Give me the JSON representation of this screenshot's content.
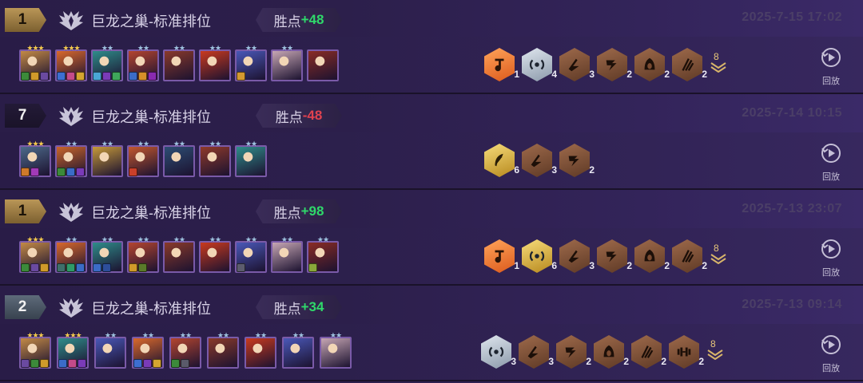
{
  "matches": [
    {
      "rank": "1",
      "rank_style": "gold",
      "mode": "巨龙之巢-标准排位",
      "points_label": "胜点",
      "points_value": "+48",
      "points_dir": "up",
      "date": "2025-7-15 17:02",
      "champions": [
        {
          "stars": "★★★",
          "star_color": "gold",
          "color": "#c38a46",
          "items": [
            "#3c8a3a",
            "#d09a2a",
            "#6a4aa0"
          ]
        },
        {
          "stars": "★★★",
          "star_color": "gold",
          "color": "#d9692c",
          "items": [
            "#3d6fd1",
            "#c44a8a",
            "#d4a530"
          ]
        },
        {
          "stars": "★★",
          "star_color": "silver",
          "color": "#2f8d8a",
          "items": [
            "#4aa7d6",
            "#7a3bb8",
            "#3fa65b"
          ]
        },
        {
          "stars": "★★",
          "star_color": "silver",
          "color": "#b4452f",
          "items": [
            "#3b6cc7",
            "#d68f2a",
            "#8a2ab0"
          ]
        },
        {
          "stars": "★★",
          "star_color": "silver",
          "color": "#8a3a2a",
          "items": []
        },
        {
          "stars": "★★",
          "star_color": "silver",
          "color": "#c93a1e",
          "items": []
        },
        {
          "stars": "★★",
          "star_color": "silver",
          "color": "#4a58b8",
          "items": [
            "#d49a30"
          ]
        },
        {
          "stars": "★★",
          "star_color": "silver",
          "color": "#c7a7b4",
          "items": []
        },
        {
          "stars": "",
          "star_color": "silver",
          "color": "#8a2c24",
          "items": []
        }
      ],
      "traits": [
        {
          "tier": "orange",
          "count": "1",
          "icon": "note-icon"
        },
        {
          "tier": "silver",
          "count": "4",
          "icon": "signal-icon"
        },
        {
          "tier": "bronze",
          "count": "3",
          "icon": "slash-icon"
        },
        {
          "tier": "bronze",
          "count": "2",
          "icon": "claw-icon"
        },
        {
          "tier": "bronze",
          "count": "2",
          "icon": "hood-icon"
        },
        {
          "tier": "bronze",
          "count": "2",
          "icon": "scratch-icon"
        }
      ],
      "more": "8",
      "replay_label": "回放"
    },
    {
      "rank": "7",
      "rank_style": "dark",
      "mode": "巨龙之巢-标准排位",
      "points_label": "胜点",
      "points_value": "-48",
      "points_dir": "down",
      "date": "2025-7-14 10:15",
      "champions": [
        {
          "stars": "★★★",
          "star_color": "gold",
          "color": "#4d6a8a",
          "items": [
            "#d07a2a",
            "#a23ab8"
          ]
        },
        {
          "stars": "★★",
          "star_color": "silver",
          "color": "#c9652a",
          "items": [
            "#3c8a3a",
            "#3b6cc7",
            "#7a3bb8"
          ]
        },
        {
          "stars": "★★",
          "star_color": "silver",
          "color": "#c79a3a",
          "items": []
        },
        {
          "stars": "★★",
          "star_color": "silver",
          "color": "#c2572e",
          "items": [
            "#c9402a"
          ]
        },
        {
          "stars": "★★",
          "star_color": "silver",
          "color": "#2d4e74",
          "items": []
        },
        {
          "stars": "★★",
          "star_color": "silver",
          "color": "#8f3a2a",
          "items": []
        },
        {
          "stars": "★★",
          "star_color": "silver",
          "color": "#2f8d8a",
          "items": []
        }
      ],
      "traits": [
        {
          "tier": "gold",
          "count": "6",
          "icon": "feather-icon"
        },
        {
          "tier": "bronze",
          "count": "3",
          "icon": "slash-icon"
        },
        {
          "tier": "bronze",
          "count": "2",
          "icon": "claw-icon"
        }
      ],
      "more": "",
      "replay_label": "回放"
    },
    {
      "rank": "1",
      "rank_style": "gold",
      "mode": "巨龙之巢-标准排位",
      "points_label": "胜点",
      "points_value": "+98",
      "points_dir": "up",
      "date": "2025-7-13 23:07",
      "champions": [
        {
          "stars": "★★★",
          "star_color": "gold",
          "color": "#c38a46",
          "items": [
            "#3c8a3a",
            "#6a4aa0",
            "#d09a2a"
          ]
        },
        {
          "stars": "★★",
          "star_color": "silver",
          "color": "#d9692c",
          "items": [
            "#3f6f6a",
            "#2f9b68",
            "#3b6cc7"
          ]
        },
        {
          "stars": "★★",
          "star_color": "silver",
          "color": "#2f8d8a",
          "items": [
            "#3b6cc7",
            "#2d4e9a"
          ]
        },
        {
          "stars": "★★",
          "star_color": "silver",
          "color": "#b4452f",
          "items": [
            "#d09a2a",
            "#5a7a2a"
          ]
        },
        {
          "stars": "★★",
          "star_color": "silver",
          "color": "#8a3a2a",
          "items": []
        },
        {
          "stars": "★★",
          "star_color": "silver",
          "color": "#c93a1e",
          "items": []
        },
        {
          "stars": "★★",
          "star_color": "silver",
          "color": "#4a58b8",
          "items": [
            "#5c5c6e"
          ]
        },
        {
          "stars": "★★",
          "star_color": "silver",
          "color": "#c7a7b4",
          "items": []
        },
        {
          "stars": "★★",
          "star_color": "silver",
          "color": "#8a2c24",
          "items": [
            "#8aa83a"
          ]
        }
      ],
      "traits": [
        {
          "tier": "orange",
          "count": "1",
          "icon": "note-icon"
        },
        {
          "tier": "gold",
          "count": "6",
          "icon": "signal-icon"
        },
        {
          "tier": "bronze",
          "count": "3",
          "icon": "slash-icon"
        },
        {
          "tier": "bronze",
          "count": "2",
          "icon": "claw-icon"
        },
        {
          "tier": "bronze",
          "count": "2",
          "icon": "hood-icon"
        },
        {
          "tier": "bronze",
          "count": "2",
          "icon": "scratch-icon"
        }
      ],
      "more": "8",
      "replay_label": "回放"
    },
    {
      "rank": "2",
      "rank_style": "silver",
      "mode": "巨龙之巢-标准排位",
      "points_label": "胜点",
      "points_value": "+34",
      "points_dir": "up",
      "date": "2025-7-13 09:14",
      "champions": [
        {
          "stars": "★★★",
          "star_color": "gold",
          "color": "#c38a46",
          "items": [
            "#6a4aa0",
            "#3c8a3a",
            "#d09a2a"
          ]
        },
        {
          "stars": "★★★",
          "star_color": "gold",
          "color": "#2f8d8a",
          "items": [
            "#3b6cc7",
            "#c44a8a",
            "#7a3bb8"
          ]
        },
        {
          "stars": "★★",
          "star_color": "silver",
          "color": "#4a58b8",
          "items": []
        },
        {
          "stars": "★★",
          "star_color": "silver",
          "color": "#d9692c",
          "items": [
            "#3d6fd1",
            "#7a3bb8",
            "#d4a530"
          ]
        },
        {
          "stars": "★★",
          "star_color": "silver",
          "color": "#b4452f",
          "items": [
            "#3c8a3a",
            "#5a5a6a"
          ]
        },
        {
          "stars": "★★",
          "star_color": "silver",
          "color": "#8a3a2a",
          "items": []
        },
        {
          "stars": "★★",
          "star_color": "silver",
          "color": "#c93a1e",
          "items": []
        },
        {
          "stars": "★★",
          "star_color": "silver",
          "color": "#4a58b8",
          "items": []
        },
        {
          "stars": "★★",
          "star_color": "silver",
          "color": "#c7a7b4",
          "items": []
        }
      ],
      "traits": [
        {
          "tier": "silver",
          "count": "3",
          "icon": "signal-icon"
        },
        {
          "tier": "bronze",
          "count": "3",
          "icon": "slash-icon"
        },
        {
          "tier": "bronze",
          "count": "2",
          "icon": "claw-icon"
        },
        {
          "tier": "bronze",
          "count": "2",
          "icon": "hood-icon"
        },
        {
          "tier": "bronze",
          "count": "2",
          "icon": "scratch-icon"
        },
        {
          "tier": "bronze",
          "count": "2",
          "icon": "dumbbell-icon"
        }
      ],
      "more": "8",
      "replay_label": "回放"
    }
  ]
}
